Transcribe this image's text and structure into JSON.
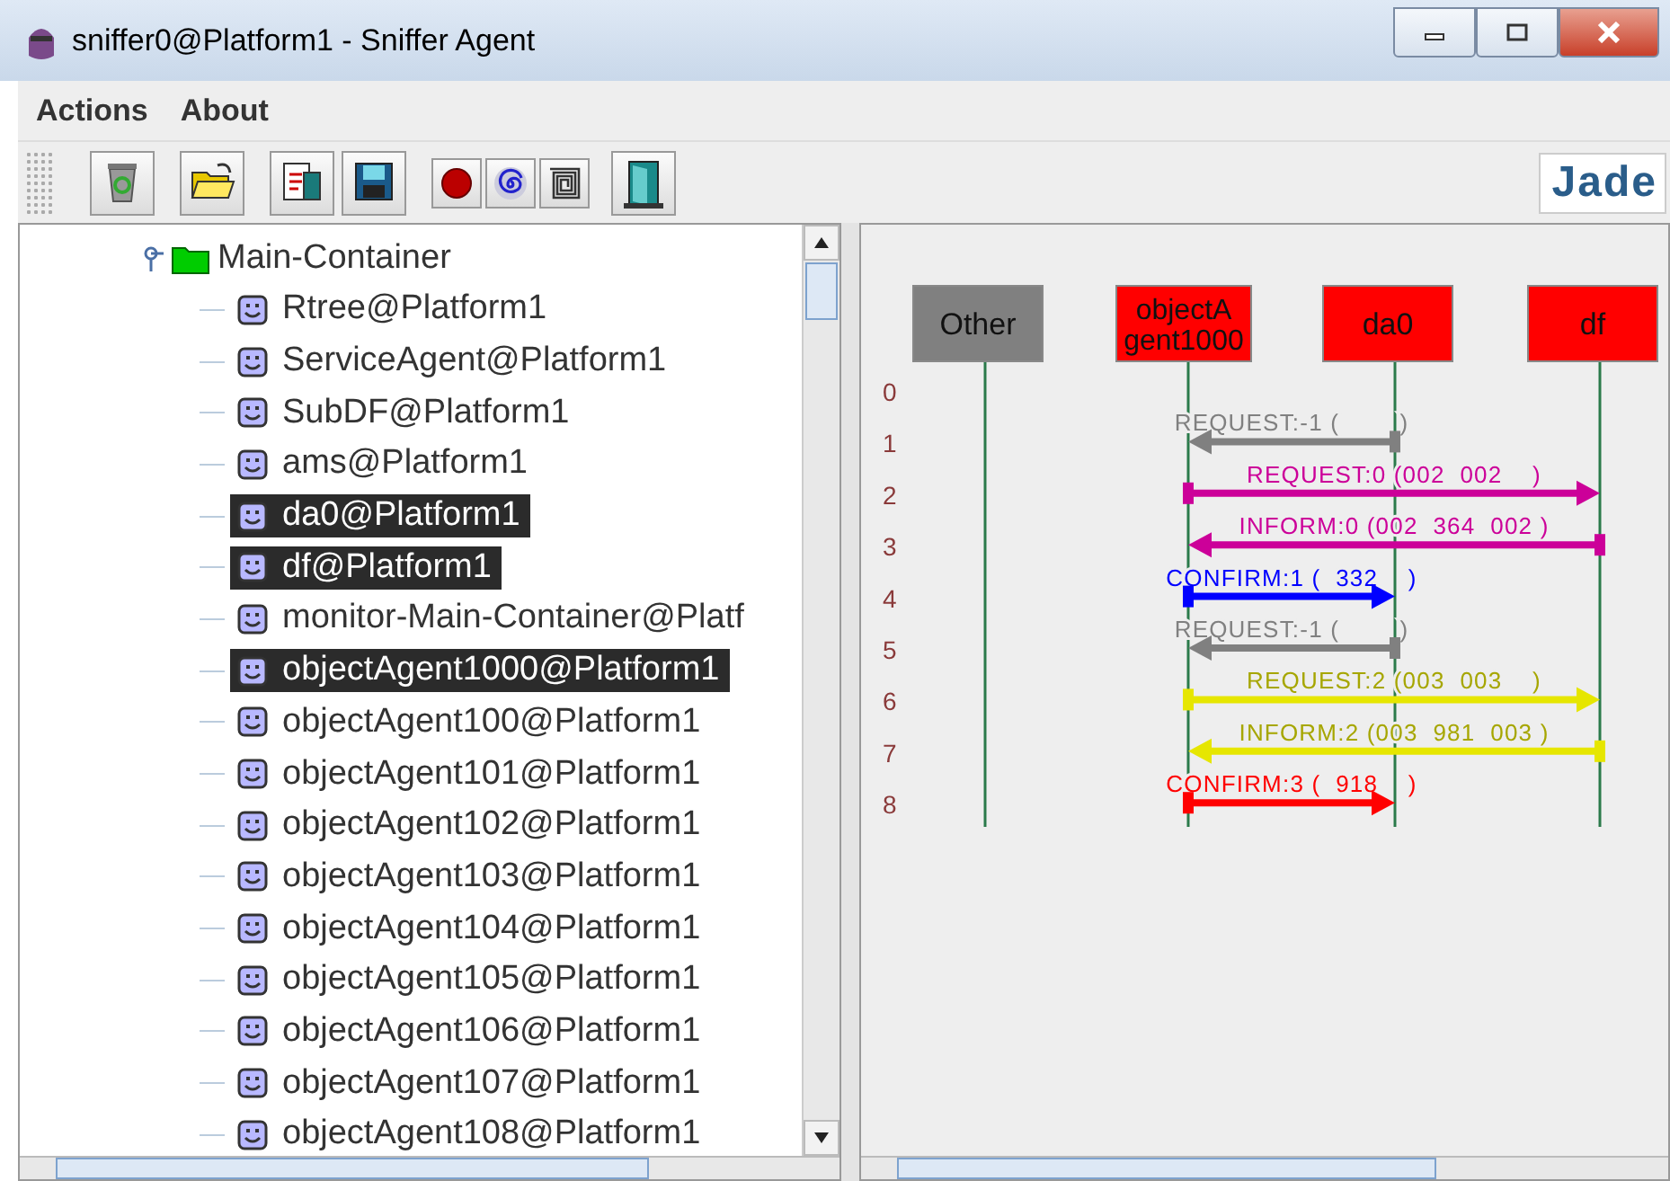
{
  "window": {
    "title": "sniffer0@Platform1 - Sniffer Agent"
  },
  "menu": [
    "Actions",
    "About"
  ],
  "toolbar": [
    {
      "kind": "trash"
    },
    {
      "kind": "open"
    },
    {
      "kind": "document"
    },
    {
      "kind": "save"
    },
    {
      "kind": "record"
    },
    {
      "kind": "spiral"
    },
    {
      "kind": "square-spiral"
    },
    {
      "kind": "exit"
    }
  ],
  "logo": {
    "text": "Jade"
  },
  "tree": {
    "label": "Main-Container",
    "expanded": true,
    "children": [
      {
        "label": "Rtree@Platform1",
        "selected": false
      },
      {
        "label": "ServiceAgent@Platform1",
        "selected": false
      },
      {
        "label": "SubDF@Platform1",
        "selected": false
      },
      {
        "label": "ams@Platform1",
        "selected": false
      },
      {
        "label": "da0@Platform1",
        "selected": true
      },
      {
        "label": "df@Platform1",
        "selected": true
      },
      {
        "label": "monitor-Main-Container@Platf",
        "selected": false
      },
      {
        "label": "objectAgent1000@Platform1",
        "selected": true
      },
      {
        "label": "objectAgent100@Platform1",
        "selected": false
      },
      {
        "label": "objectAgent101@Platform1",
        "selected": false
      },
      {
        "label": "objectAgent102@Platform1",
        "selected": false
      },
      {
        "label": "objectAgent103@Platform1",
        "selected": false
      },
      {
        "label": "objectAgent104@Platform1",
        "selected": false
      },
      {
        "label": "objectAgent105@Platform1",
        "selected": false
      },
      {
        "label": "objectAgent106@Platform1",
        "selected": false
      },
      {
        "label": "objectAgent107@Platform1",
        "selected": false
      },
      {
        "label": "objectAgent108@Platform1",
        "selected": false
      }
    ]
  },
  "sequence": {
    "agents": [
      {
        "lines": [
          "Other"
        ],
        "color": "#808080"
      },
      {
        "lines": [
          "objectA",
          "gent1000"
        ],
        "color": "#ff0000"
      },
      {
        "lines": [
          "da0"
        ],
        "color": "#ff0000"
      },
      {
        "lines": [
          "df"
        ],
        "color": "#ff0000"
      }
    ],
    "rows": [
      {
        "number": "0"
      },
      {
        "number": "1",
        "message": {
          "label": "REQUEST:-1 (        )",
          "kind": "left-short",
          "color": "#808080"
        }
      },
      {
        "number": "2",
        "message": {
          "label": "REQUEST:0 (002  002    )",
          "kind": "right-long",
          "color": "#cc0099"
        }
      },
      {
        "number": "3",
        "message": {
          "label": "INFORM:0 (002  364  002 )",
          "kind": "left-long",
          "color": "#cc0099"
        }
      },
      {
        "number": "4",
        "message": {
          "label": "CONFIRM:1 (  332    )",
          "kind": "right-short",
          "color": "#0000ff"
        }
      },
      {
        "number": "5",
        "message": {
          "label": "REQUEST:-1 (        )",
          "kind": "left-short",
          "color": "#808080"
        }
      },
      {
        "number": "6",
        "message": {
          "label": "REQUEST:2 (003  003    )",
          "kind": "right-long",
          "color": "#e6e600"
        }
      },
      {
        "number": "7",
        "message": {
          "label": "INFORM:2 (003  981  003 )",
          "kind": "left-long",
          "color": "#e6e600"
        }
      },
      {
        "number": "8",
        "message": {
          "label": "CONFIRM:3 (  918    )",
          "kind": "right-short",
          "color": "#ff0000"
        }
      }
    ]
  }
}
